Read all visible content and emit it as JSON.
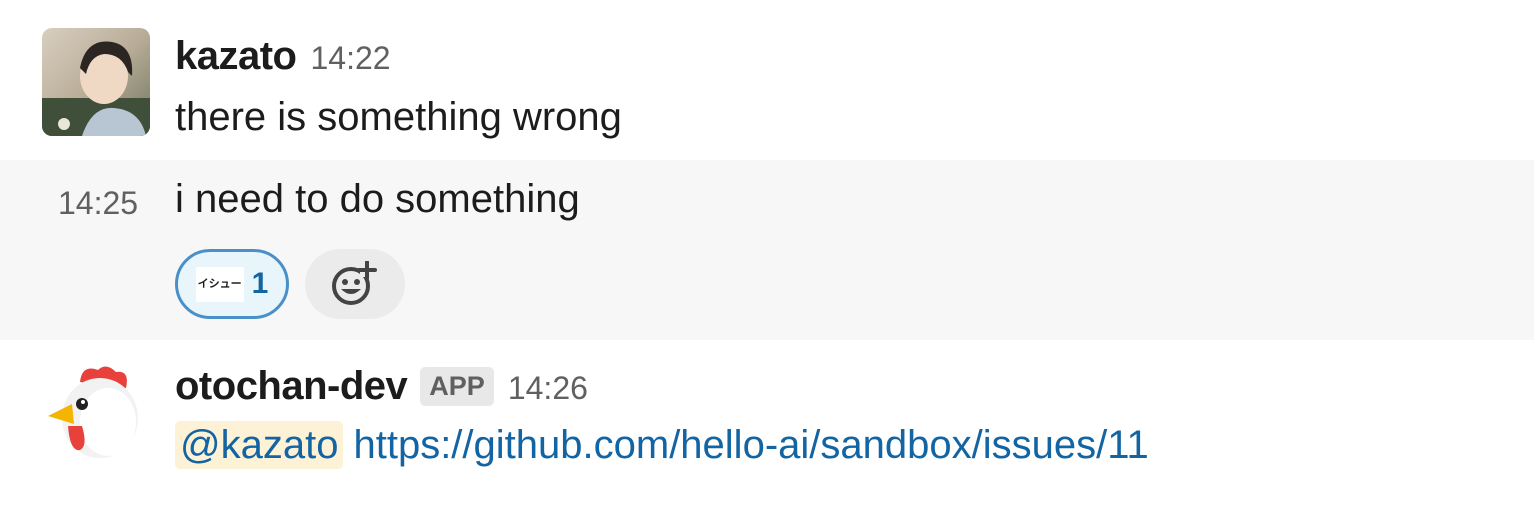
{
  "messages": [
    {
      "username": "kazato",
      "time": "14:22",
      "text": "there is something wrong"
    },
    {
      "hover_time": "14:25",
      "text": "i need to do something",
      "reactions": [
        {
          "emoji_label": "イシュー",
          "count": "1"
        }
      ],
      "add_reaction_icon": "add-reaction-icon"
    },
    {
      "username": "otochan-dev",
      "badge": "APP",
      "time": "14:26",
      "mention": "@kazato",
      "link": "https://github.com/hello-ai/sandbox/issues/11"
    }
  ],
  "colors": {
    "link": "#1264a3",
    "reaction_border": "#4a90c8",
    "mention_bg": "#fdf1d6",
    "hover_bg": "#f7f7f7"
  }
}
